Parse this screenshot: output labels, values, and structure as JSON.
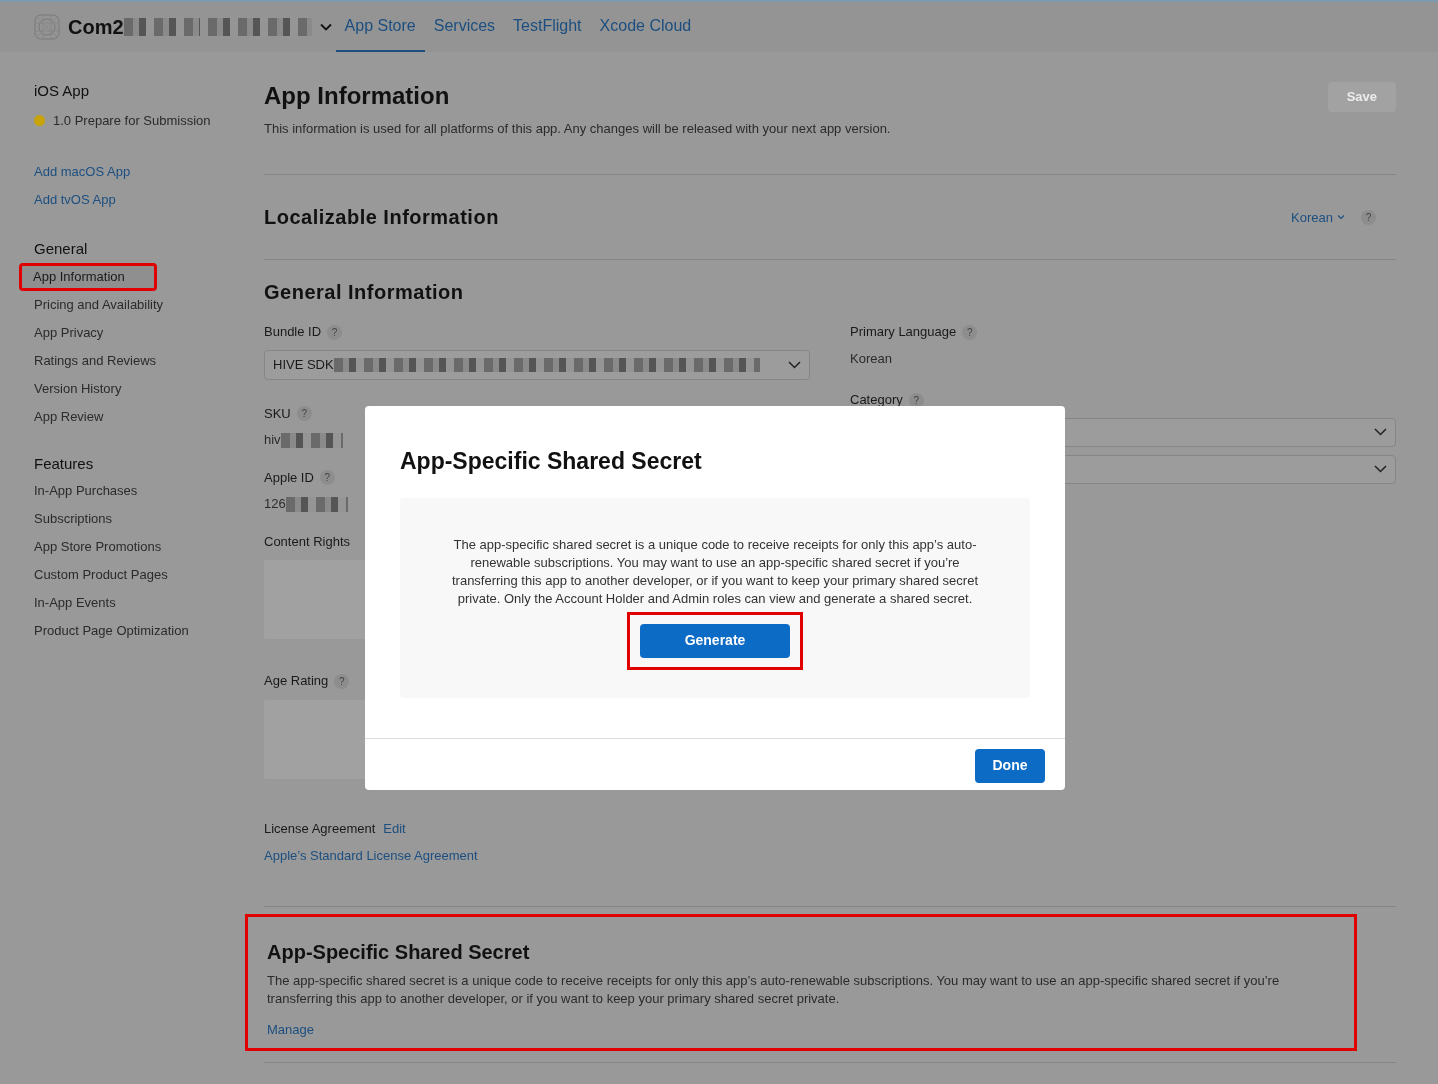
{
  "header": {
    "team": {
      "text": "Com2",
      "redacted": true
    },
    "nav": [
      {
        "label": "App Store",
        "selected": true
      },
      {
        "label": "Services",
        "selected": false
      },
      {
        "label": "TestFlight",
        "selected": false
      },
      {
        "label": "Xcode Cloud",
        "selected": false
      }
    ]
  },
  "sidebar": {
    "app": {
      "title": "iOS App",
      "status": "1.0 Prepare for Submission",
      "color": "#c9a30a"
    },
    "links": [
      "Add macOS App",
      "Add tvOS App"
    ],
    "sections": [
      {
        "title": "General",
        "items": [
          {
            "label": "App Information",
            "selected": true,
            "highlighted": true
          },
          {
            "label": "Pricing and Availability",
            "selected": false,
            "highlighted": false
          },
          {
            "label": "App Privacy",
            "selected": false,
            "highlighted": false
          },
          {
            "label": "Ratings and Reviews",
            "selected": false,
            "highlighted": false
          },
          {
            "label": "Version History",
            "selected": false,
            "highlighted": false
          },
          {
            "label": "App Review",
            "selected": false,
            "highlighted": false
          }
        ]
      },
      {
        "title": "Features",
        "items": [
          {
            "label": "In-App Purchases",
            "selected": false,
            "highlighted": false
          },
          {
            "label": "Subscriptions",
            "selected": false,
            "highlighted": false
          },
          {
            "label": "App Store Promotions",
            "selected": false,
            "highlighted": false
          },
          {
            "label": "Custom Product Pages",
            "selected": false,
            "highlighted": false
          },
          {
            "label": "In-App Events",
            "selected": false,
            "highlighted": false
          },
          {
            "label": "Product Page Optimization",
            "selected": false,
            "highlighted": false
          }
        ]
      }
    ]
  },
  "page": {
    "title": "App Information",
    "subtitle": "This information is used for all platforms of this app. Any changes will be released with your next app version.",
    "save_button": {
      "label": "Save",
      "disabled": true
    }
  },
  "localizable": {
    "title": "Localizable Information",
    "language": "Korean",
    "help": "?"
  },
  "general": {
    "title": "General Information",
    "left": [
      {
        "kind": "select",
        "label": "Bundle ID",
        "help": "?",
        "value": "HIVE SDK",
        "redacted": true
      },
      {
        "kind": "text",
        "label": "SKU",
        "help": "?",
        "value": "hiv",
        "redacted": true
      },
      {
        "kind": "text",
        "label": "Apple ID",
        "help": "?",
        "value": "126",
        "redacted": true
      },
      {
        "kind": "box",
        "label": "Content Rights"
      },
      {
        "kind": "box",
        "label": "Age Rating",
        "help": "?"
      }
    ],
    "right": [
      {
        "kind": "text",
        "label": "Primary Language",
        "help": "?",
        "value": "Korean"
      },
      {
        "kind": "selects",
        "label": "Category",
        "help": "?"
      }
    ]
  },
  "license": {
    "label": "License Agreement",
    "edit": "Edit",
    "link": "Apple’s Standard License Agreement"
  },
  "secret_section": {
    "title": "App-Specific Shared Secret",
    "text": "The app-specific shared secret is a unique code to receive receipts for only this app’s auto-renewable subscriptions. You may want to use an app-specific shared secret if you’re transferring this app to another developer, or if you want to keep your primary shared secret private.",
    "link": "Manage",
    "highlighted": true
  },
  "modal": {
    "title": "App-Specific Shared Secret",
    "text": "The app-specific shared secret is a unique code to receive receipts for only this app’s auto-renewable subscriptions. You may want to use an app-specific shared secret if you’re transferring this app to another developer, or if you want to keep your primary shared secret private. Only the Account Holder and Admin roles can view and generate a shared secret.",
    "generate": {
      "label": "Generate",
      "highlighted": true
    },
    "done": "Done"
  }
}
